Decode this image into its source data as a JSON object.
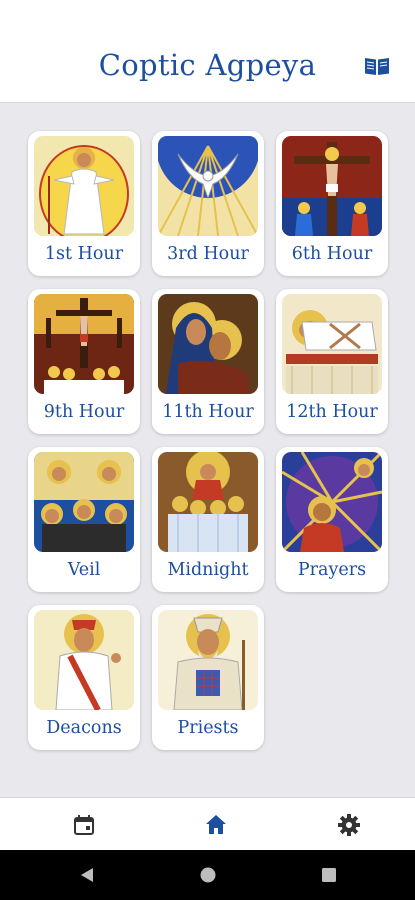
{
  "app": {
    "title": "Coptic Agpeya"
  },
  "header": {
    "book_icon": "open-book-icon"
  },
  "hours": [
    {
      "label": "1st Hour",
      "icon": "resurrection-icon"
    },
    {
      "label": "3rd Hour",
      "icon": "holy-spirit-dove-icon"
    },
    {
      "label": "6th Hour",
      "icon": "crucifixion-icon"
    },
    {
      "label": "9th Hour",
      "icon": "crucifixion-mourners-icon"
    },
    {
      "label": "11th Hour",
      "icon": "virgin-mary-lament-icon"
    },
    {
      "label": "12th Hour",
      "icon": "burial-icon"
    },
    {
      "label": "Veil",
      "icon": "monastic-saints-icon"
    },
    {
      "label": "Midnight",
      "icon": "christ-with-angels-icon"
    },
    {
      "label": "Prayers",
      "icon": "praying-saint-icon"
    },
    {
      "label": "Deacons",
      "icon": "deacon-saint-icon"
    },
    {
      "label": "Priests",
      "icon": "priest-saint-icon"
    }
  ],
  "bottom_nav": [
    {
      "name": "calendar",
      "icon": "calendar-icon",
      "active": false
    },
    {
      "name": "home",
      "icon": "home-icon",
      "active": true
    },
    {
      "name": "settings",
      "icon": "gear-icon",
      "active": false
    }
  ],
  "colors": {
    "accent": "#1d4fa0",
    "background": "#e9e9ed",
    "card": "#ffffff"
  }
}
